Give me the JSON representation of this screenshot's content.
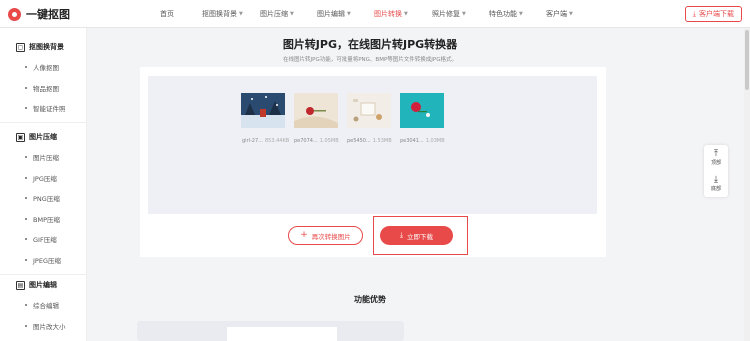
{
  "header": {
    "logo_text": "一键抠图",
    "nav": [
      {
        "label": "首页",
        "caret": false
      },
      {
        "label": "抠图换背景",
        "caret": true
      },
      {
        "label": "图片压缩",
        "caret": true
      },
      {
        "label": "图片编辑",
        "caret": true
      },
      {
        "label": "图片转换",
        "caret": true
      },
      {
        "label": "照片修复",
        "caret": true
      },
      {
        "label": "特色功能",
        "caret": true
      },
      {
        "label": "客户端",
        "caret": true
      }
    ],
    "active_nav": "图片转换",
    "download_client_label": "客户端下载",
    "download_icon": "download-icon"
  },
  "sidebar": {
    "groups": [
      {
        "title": "抠图换背景",
        "icon": "cutout-icon",
        "items": [
          "人像抠图",
          "物品抠图",
          "智能证件照"
        ]
      },
      {
        "title": "图片压缩",
        "icon": "compress-icon",
        "items": [
          "图片压缩",
          "JPG压缩",
          "PNG压缩",
          "BMP压缩",
          "GIF压缩",
          "JPEG压缩"
        ]
      },
      {
        "title": "图片编辑",
        "icon": "edit-icon",
        "items": [
          "综合编辑",
          "图片改大小"
        ]
      }
    ]
  },
  "main": {
    "title": "图片转JPG，在线图片转JPG转换器",
    "subtitle": "在线图片转JPG功能，可批量将PNG、BMP等图片文件转换成JPG格式。",
    "files": [
      {
        "name": "girl-27...",
        "size": "853.44KB"
      },
      {
        "name": "pe7074...",
        "size": "1.05MB"
      },
      {
        "name": "pe5450...",
        "size": "1.53MB"
      },
      {
        "name": "pe3041...",
        "size": "1.03MB"
      }
    ],
    "convert_again_label": "再次转换图片",
    "download_now_label": "立即下载",
    "feature_title": "功能优势"
  },
  "float_tools": {
    "top_label": "顶部",
    "bottom_label": "底部"
  },
  "colors": {
    "accent": "#e84a4a",
    "upload_area": "#eef0f6"
  }
}
